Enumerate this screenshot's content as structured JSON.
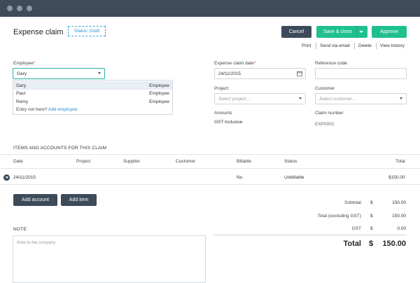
{
  "header": {
    "title": "Expense claim",
    "status": "Status: Draft",
    "cancel_label": "Cancel",
    "save_close_label": "Save & close",
    "approve_label": "Approve",
    "links": [
      "Print",
      "Send via email",
      "Delete",
      "View history"
    ]
  },
  "form": {
    "employee_label": "Employee",
    "employee_value": "Gary",
    "employee_options": [
      {
        "name": "Gary",
        "role": "Employee"
      },
      {
        "name": "Paul",
        "role": "Employee"
      },
      {
        "name": "Remy",
        "role": "Employee"
      }
    ],
    "not_here_text": "Entry not here?",
    "add_employee_label": "Add employee",
    "claim_date_label": "Expense claim date",
    "claim_date_value": "24/11/2015",
    "reference_label": "Reference code",
    "project_label": "Project",
    "project_placeholder": "Select project...",
    "customer_label": "Customer",
    "customer_placeholder": "Select customer...",
    "amounts_label": "Amounts",
    "amounts_value": "GST Inclusive",
    "claim_number_label": "Claim number",
    "claim_number_value": "EXP0001",
    "required_mark": "*"
  },
  "items": {
    "section_title": "ITEMS AND ACCOUNTS FOR THIS CLAIM",
    "columns": [
      "Date",
      "Project",
      "Supplier",
      "Customer",
      "Billable",
      "Status",
      "Total"
    ],
    "rows": [
      {
        "date": "24/11/2015",
        "billable": "No",
        "status": "Unbillable",
        "total": "$150.00"
      }
    ],
    "add_account_label": "Add account",
    "add_item_label": "Add item"
  },
  "totals": {
    "currency": "$",
    "subtotal_label": "Subtotal",
    "subtotal": "150.00",
    "excl_label": "Total (excluding GST)",
    "excl": "150.00",
    "gst_label": "GST",
    "gst": "0.00",
    "total_label": "Total",
    "total": "150.00"
  },
  "note": {
    "label": "NOTE:",
    "placeholder": "Note to the company"
  },
  "colors": {
    "titlebar": "#3f4b5b",
    "accent_green": "#1fc08e",
    "dark_button": "#3d4a59",
    "link_blue": "#2b8fc9"
  }
}
